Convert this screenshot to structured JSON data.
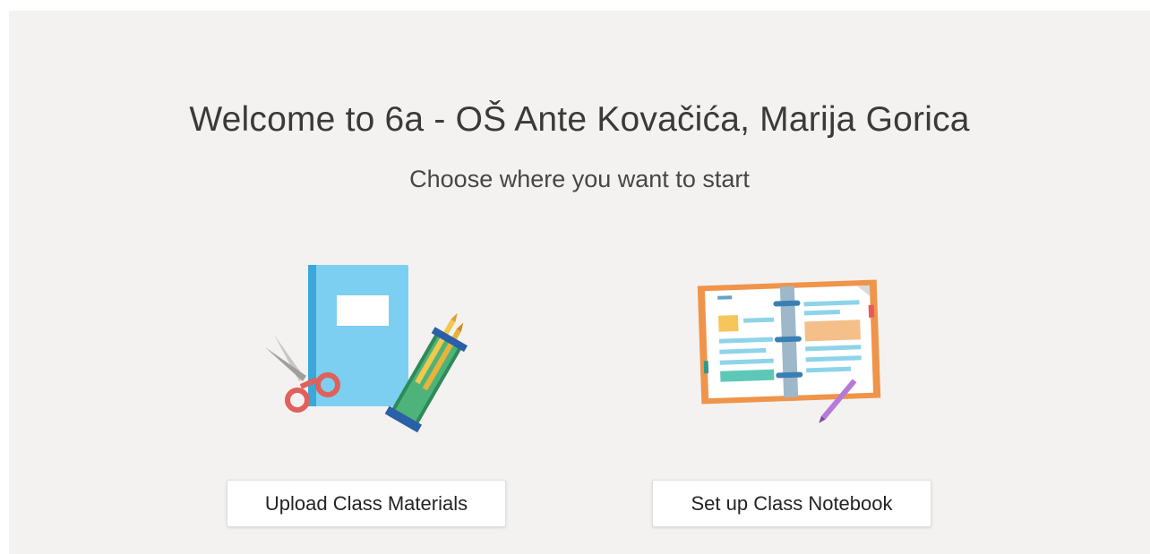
{
  "header": {
    "title": "Welcome to 6a - OŠ Ante Kovačića, Marija Gorica",
    "subtitle": "Choose where you want to start"
  },
  "options": [
    {
      "button_label": "Upload Class Materials",
      "icon": "class-materials-illustration"
    },
    {
      "button_label": "Set up Class Notebook",
      "icon": "class-notebook-illustration"
    }
  ],
  "colors": {
    "background": "#f3f2f1",
    "button_bg": "#ffffff",
    "text": "#3b3a39"
  }
}
